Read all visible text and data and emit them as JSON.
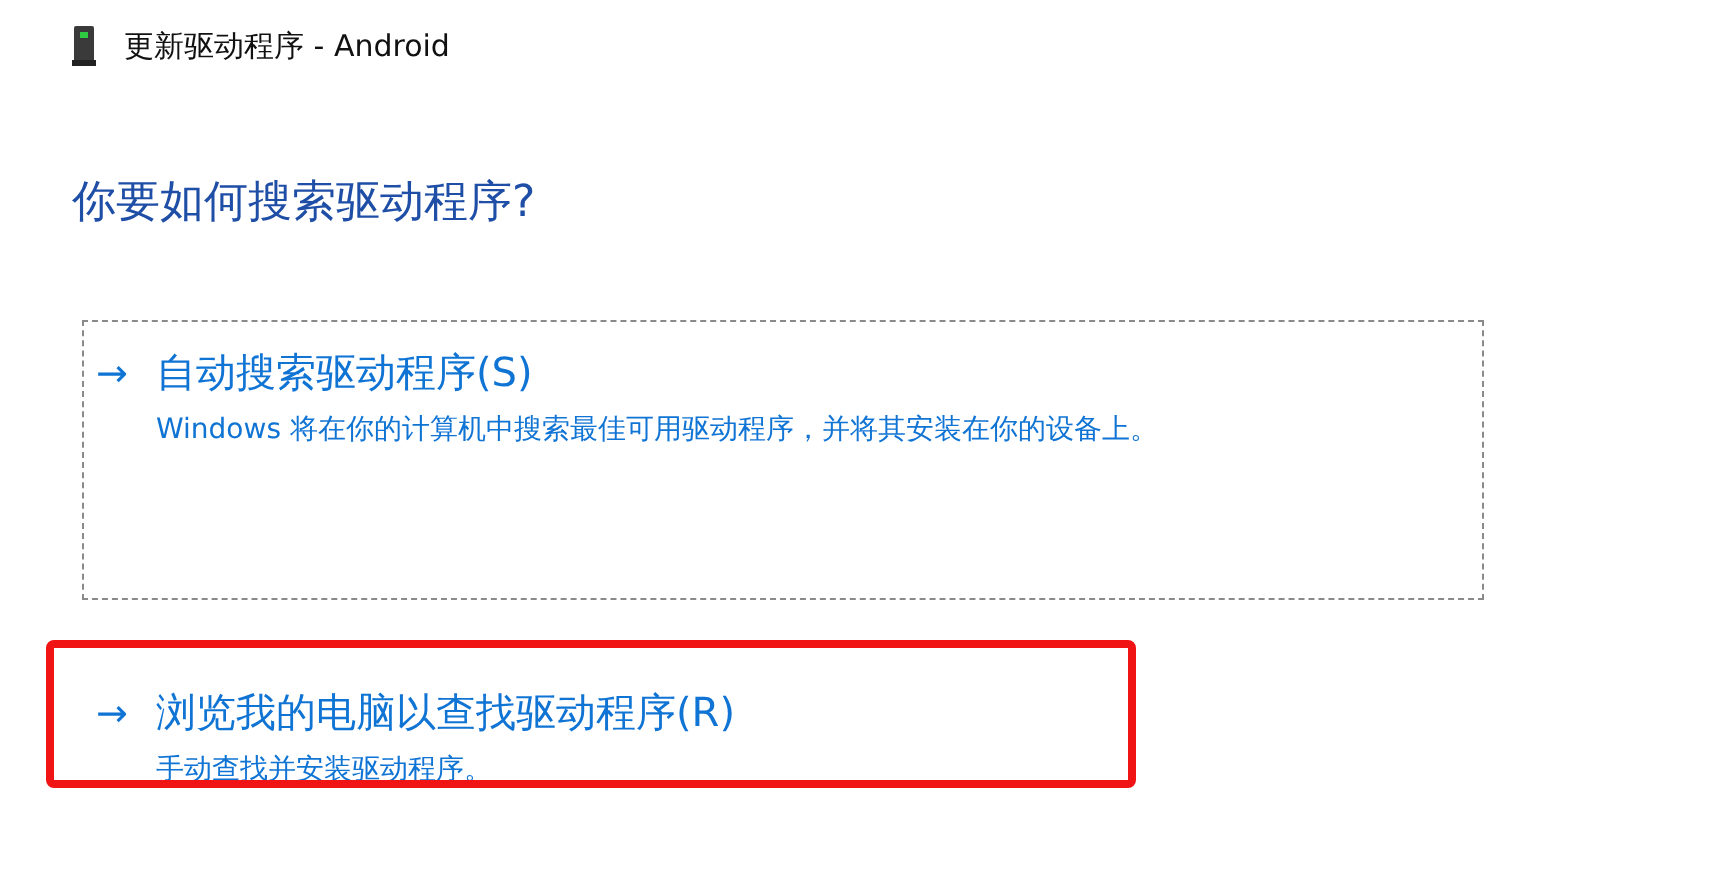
{
  "window": {
    "title": "更新驱动程序 - Android"
  },
  "heading": "你要如何搜索驱动程序?",
  "options": [
    {
      "arrow": "→",
      "title": "自动搜索驱动程序(S)",
      "description": "Windows 将在你的计算机中搜索最佳可用驱动程序，并将其安装在你的设备上。",
      "focused": true,
      "highlighted": false
    },
    {
      "arrow": "→",
      "title": "浏览我的电脑以查找驱动程序(R)",
      "description": "手动查找并安装驱动程序。",
      "focused": false,
      "highlighted": true
    }
  ]
}
